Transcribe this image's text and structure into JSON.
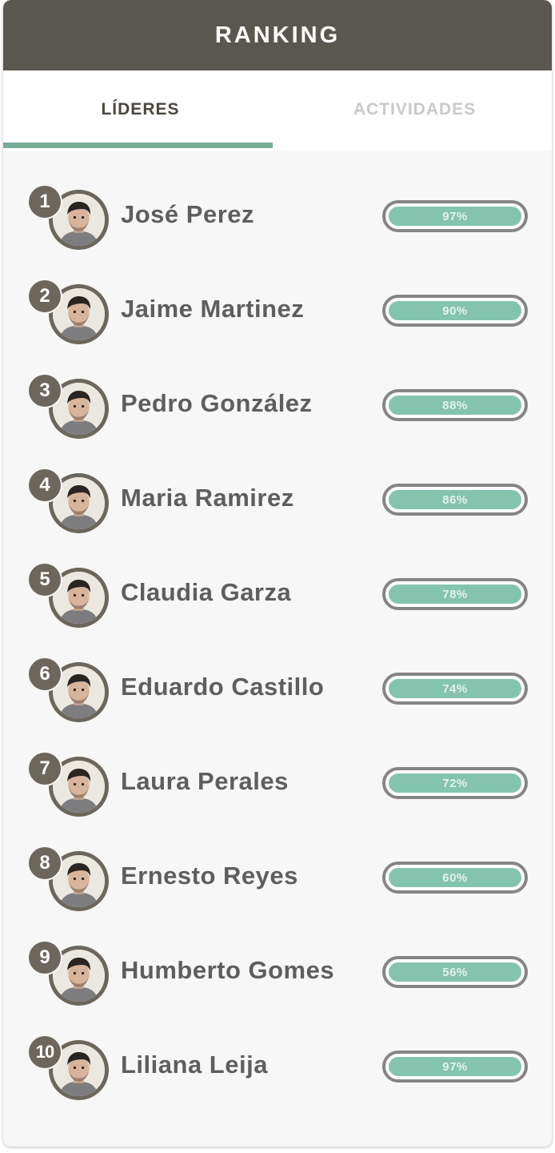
{
  "header": {
    "title": "RANKING"
  },
  "tabs": [
    {
      "label": "LÍDERES",
      "active": true
    },
    {
      "label": "ACTIVIDADES",
      "active": false
    }
  ],
  "colors": {
    "header_bg": "#5a5750",
    "accent": "#77ac96",
    "bar_fill": "#84c4ae",
    "badge_bg": "#6c665d"
  },
  "leaders": [
    {
      "rank": "1",
      "name": "José Perez",
      "percent": "97%",
      "progress": 0.97
    },
    {
      "rank": "2",
      "name": "Jaime Martinez",
      "percent": "90%",
      "progress": 0.9
    },
    {
      "rank": "3",
      "name": "Pedro González",
      "percent": "88%",
      "progress": 0.88
    },
    {
      "rank": "4",
      "name": "Maria Ramirez",
      "percent": "86%",
      "progress": 0.86
    },
    {
      "rank": "5",
      "name": "Claudia Garza",
      "percent": "78%",
      "progress": 0.78
    },
    {
      "rank": "6",
      "name": "Eduardo Castillo",
      "percent": "74%",
      "progress": 0.74
    },
    {
      "rank": "7",
      "name": "Laura Perales",
      "percent": "72%",
      "progress": 0.72
    },
    {
      "rank": "8",
      "name": "Ernesto Reyes",
      "percent": "60%",
      "progress": 0.6
    },
    {
      "rank": "9",
      "name": "Humberto Gomes",
      "percent": "56%",
      "progress": 0.56
    },
    {
      "rank": "10",
      "name": "Liliana Leija",
      "percent": "97%",
      "progress": 0.97
    }
  ]
}
